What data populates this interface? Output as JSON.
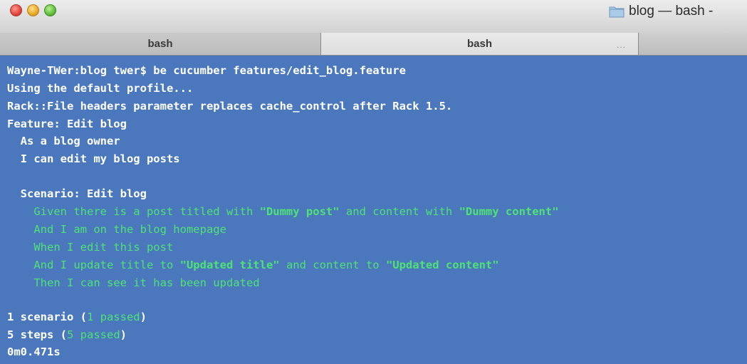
{
  "window": {
    "title": "blog — bash -",
    "tabs": [
      {
        "label": "bash"
      },
      {
        "label": "bash"
      }
    ],
    "tab_overflow": "..."
  },
  "terminal": {
    "lines": [
      {
        "text": "Wayne-TWer:blog twer$ be cucumber features/edit_blog.feature"
      },
      {
        "text": "Using the default profile..."
      },
      {
        "text": "Rack::File headers parameter replaces cache_control after Rack 1.5."
      },
      {
        "text": "Feature: Edit blog"
      },
      {
        "text": "  As a blog owner"
      },
      {
        "text": "  I can edit my blog posts"
      },
      {
        "text": "  Scenario: Edit blog"
      }
    ],
    "steps": {
      "s1": {
        "a": "    Given there is a post titled with ",
        "b": "\"Dummy post\"",
        "c": " and content with ",
        "d": "\"Dummy content\""
      },
      "s2": "    And I am on the blog homepage",
      "s3": "    When I edit this post",
      "s4": {
        "a": "    And I update title to ",
        "b": "\"Updated title\"",
        "c": " and content to ",
        "d": "\"Updated content\""
      },
      "s5": "    Then I can see it has been updated"
    },
    "summary": {
      "scenarios": {
        "pre": "1 scenario (",
        "count": "1 passed",
        "post": ")"
      },
      "steps": {
        "pre": "5 steps (",
        "count": "5 passed",
        "post": ")"
      },
      "time": "0m0.471s"
    }
  },
  "colors": {
    "background": "#4b78bd",
    "text": "#ffffff",
    "passed": "#4ee276"
  }
}
